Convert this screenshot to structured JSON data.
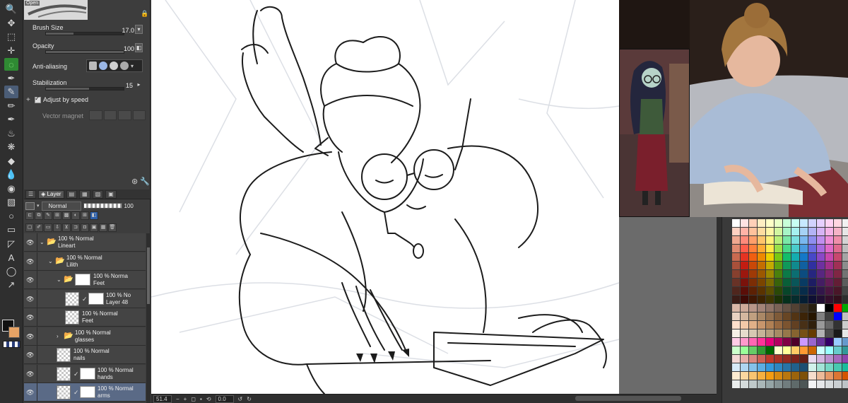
{
  "toolbar": {
    "tools": [
      "zoom-icon",
      "move-icon",
      "select-icon",
      "transform-icon",
      "lasso-icon",
      "eyedropper-icon",
      "pen-icon",
      "pencil-icon",
      "brush-icon",
      "airbrush-icon",
      "decoration-icon",
      "eraser-icon",
      "blend-icon",
      "fill-icon",
      "gradient-icon",
      "shape-icon",
      "frame-icon",
      "ruler-icon",
      "text-icon",
      "balloon-icon",
      "correct-line-icon"
    ]
  },
  "tool_property": {
    "preview_tag": "Open",
    "brush_size": {
      "label": "Brush Size",
      "value": "17.0",
      "level": 0.35
    },
    "opacity": {
      "label": "Opacity",
      "value": "100",
      "level": 1.0
    },
    "anti_aliasing": {
      "label": "Anti-aliasing"
    },
    "stabilization": {
      "label": "Stabilization",
      "value": "15",
      "level": 0.55
    },
    "adjust_by_speed": {
      "label": "Adjust by speed",
      "checked": true
    },
    "vector_magnet": {
      "label": "Vector magnet"
    }
  },
  "layer_panel": {
    "tab_label": "Layer",
    "blend_mode": "Normal",
    "opacity": "100",
    "layers": [
      {
        "name": "Lineart",
        "meta": "100 % Normal",
        "kind": "folder",
        "indent": 0,
        "open": true
      },
      {
        "name": "Lilith",
        "meta": "100 % Normal",
        "kind": "folder",
        "indent": 1,
        "open": true
      },
      {
        "name": "Feet",
        "meta": "100 % Norma",
        "kind": "folder-mask",
        "indent": 2,
        "open": true
      },
      {
        "name": "Layer 48",
        "meta": "100 % No",
        "kind": "raster-mask",
        "indent": 3
      },
      {
        "name": "Feet",
        "meta": "100 % Normal",
        "kind": "raster",
        "indent": 3
      },
      {
        "name": "glasses",
        "meta": "100 % Normal",
        "kind": "folder",
        "indent": 2,
        "open": false
      },
      {
        "name": "nails",
        "meta": "100 % Normal",
        "kind": "raster",
        "indent": 2
      },
      {
        "name": "hands",
        "meta": "100 % Normal",
        "kind": "raster-mask",
        "indent": 2
      },
      {
        "name": "arms",
        "meta": "100 % Normal",
        "kind": "raster-mask",
        "indent": 2,
        "selected": true
      }
    ]
  },
  "status": {
    "zoom": "51.4",
    "angle": "0.0"
  },
  "colors": {
    "accent": "#4b5d77",
    "selected_layer": "#5a6a86",
    "foreground": "#111111",
    "background": "#e6a365"
  },
  "palette": [
    "#ffffff",
    "#ffe3e3",
    "#ffd0b8",
    "#ffeec2",
    "#ffffc7",
    "#e9ffc7",
    "#c7ffd9",
    "#c7fff3",
    "#c7e9ff",
    "#d2d2ff",
    "#e7cfff",
    "#ffd2f2",
    "#ffd6e0",
    "#f2f2f2",
    "#ffd1c2",
    "#ffb3a7",
    "#ffc29c",
    "#ffdca0",
    "#fff5a6",
    "#d2f5a0",
    "#a6f5c7",
    "#a6f0f0",
    "#a6d2f5",
    "#b3b3f5",
    "#d7b3f5",
    "#f5b3e6",
    "#f5b3c7",
    "#e6e6e6",
    "#f0a890",
    "#ff8a7a",
    "#ff9f6a",
    "#ffc46a",
    "#fff07a",
    "#b8ef7a",
    "#7ae8a8",
    "#7ae0e0",
    "#7ab8ef",
    "#8e8eef",
    "#c08eef",
    "#ef8ed8",
    "#ef8eaa",
    "#d4d4d4",
    "#e08a70",
    "#ff5c4a",
    "#ff7f3a",
    "#ffaa33",
    "#ffe84a",
    "#99e04a",
    "#4ad988",
    "#4acccc",
    "#4a9be0",
    "#6a6ae0",
    "#a86ae0",
    "#e06ac8",
    "#e06a8e",
    "#bdbdbd",
    "#c96a50",
    "#e63322",
    "#f05e10",
    "#ee8a00",
    "#ecd000",
    "#78c814",
    "#14bd6a",
    "#14adb0",
    "#1478c8",
    "#4848c8",
    "#8a48c8",
    "#c848ae",
    "#c8486e",
    "#a4a4a4",
    "#a8503a",
    "#c21d12",
    "#c94808",
    "#c46e00",
    "#c4ab00",
    "#5ea010",
    "#10985a",
    "#108a8e",
    "#1060a0",
    "#3030a0",
    "#6e30a0",
    "#a0308a",
    "#a03056",
    "#8c8c8c",
    "#87402e",
    "#9c170e",
    "#a03a06",
    "#9c5800",
    "#9c8800",
    "#4a800c",
    "#0c7a48",
    "#0c6e72",
    "#0c4c80",
    "#262680",
    "#582680",
    "#80266e",
    "#802644",
    "#737373",
    "#683226",
    "#7a120b",
    "#7c2d05",
    "#7a4500",
    "#7a6a00",
    "#39630a",
    "#095f38",
    "#095659",
    "#093b63",
    "#1d1d63",
    "#441d63",
    "#631d56",
    "#631d35",
    "#5c5c5c",
    "#4f261d",
    "#5a0e08",
    "#5c2104",
    "#5a3300",
    "#5a4e00",
    "#2a4907",
    "#07462a",
    "#074042",
    "#072c4a",
    "#16164a",
    "#32164a",
    "#4a1640",
    "#4a1628",
    "#454545",
    "#3a1c16",
    "#3d0a06",
    "#3f1703",
    "#3d2300",
    "#3d3500",
    "#1d3205",
    "#05301c",
    "#052c2d",
    "#051e33",
    "#0f0f33",
    "#220f33",
    "#330f2c",
    "#330f1c",
    "#2e2e2e",
    "#d9b8a8",
    "#ccaa99",
    "#b89688",
    "#a38477",
    "#8f7366",
    "#7a6255",
    "#665244",
    "#524133",
    "#3d3122",
    "#292011",
    "#ffffff",
    "#000000",
    "#ff0000",
    "#00aa00",
    "#e8d2c2",
    "#d4b8a0",
    "#c0a080",
    "#aa8866",
    "#94704e",
    "#7e5a38",
    "#684624",
    "#523414",
    "#3c2408",
    "#261600",
    "#808080",
    "#404040",
    "#0000ff",
    "#c0c0c0",
    "#ffe0cc",
    "#f2c9a8",
    "#e0b088",
    "#c8966c",
    "#b08054",
    "#966840",
    "#7c5430",
    "#624022",
    "#483016",
    "#30200c",
    "#999999",
    "#666666",
    "#333333",
    "#cccccc",
    "#f5f0e6",
    "#e6dccc",
    "#d6c8b2",
    "#c6b498",
    "#b6a07e",
    "#a68c64",
    "#96784a",
    "#866430",
    "#765016",
    "#663c00",
    "#b3b3b3",
    "#4d4d4d",
    "#1a1a1a",
    "#e6e6e6",
    "#ffcce6",
    "#ff99cc",
    "#ff66b3",
    "#ff3399",
    "#e6007a",
    "#b3005f",
    "#800044",
    "#4d0029",
    "#cc99ff",
    "#9966cc",
    "#663399",
    "#330066",
    "#99ccff",
    "#6699cc",
    "#ccffcc",
    "#99ff99",
    "#66cc66",
    "#339933",
    "#006600",
    "#ffffcc",
    "#ffff99",
    "#ffcc66",
    "#ff9933",
    "#cc6600",
    "#ccffff",
    "#99ffff",
    "#66cccc",
    "#339999",
    "#f2d7d5",
    "#e6b0aa",
    "#d98880",
    "#cd6155",
    "#c0392b",
    "#a93226",
    "#922b21",
    "#7b241c",
    "#641e16",
    "#e8daef",
    "#d2b4de",
    "#bb8fce",
    "#a569bd",
    "#8e44ad",
    "#d6eaf8",
    "#aed6f1",
    "#85c1e9",
    "#5dade2",
    "#3498db",
    "#2e86c1",
    "#2874a6",
    "#21618c",
    "#1b4f72",
    "#d1f2eb",
    "#a3e4d7",
    "#76d7c4",
    "#48c9b0",
    "#1abc9c",
    "#fdebd0",
    "#fad7a0",
    "#f8c471",
    "#f5b041",
    "#f39c12",
    "#d68910",
    "#b9770e",
    "#9c640c",
    "#7e5109",
    "#f6ddcc",
    "#edbb99",
    "#e59866",
    "#dc7633",
    "#d35400",
    "#eaeded",
    "#d5dbdb",
    "#bfc9ca",
    "#aab7b8",
    "#95a5a6",
    "#839192",
    "#717d7e",
    "#5f6a6a",
    "#4d5656",
    "#f2f3f4",
    "#e5e7e9",
    "#d7dbdd",
    "#cacfd2",
    "#bdc3c7"
  ]
}
